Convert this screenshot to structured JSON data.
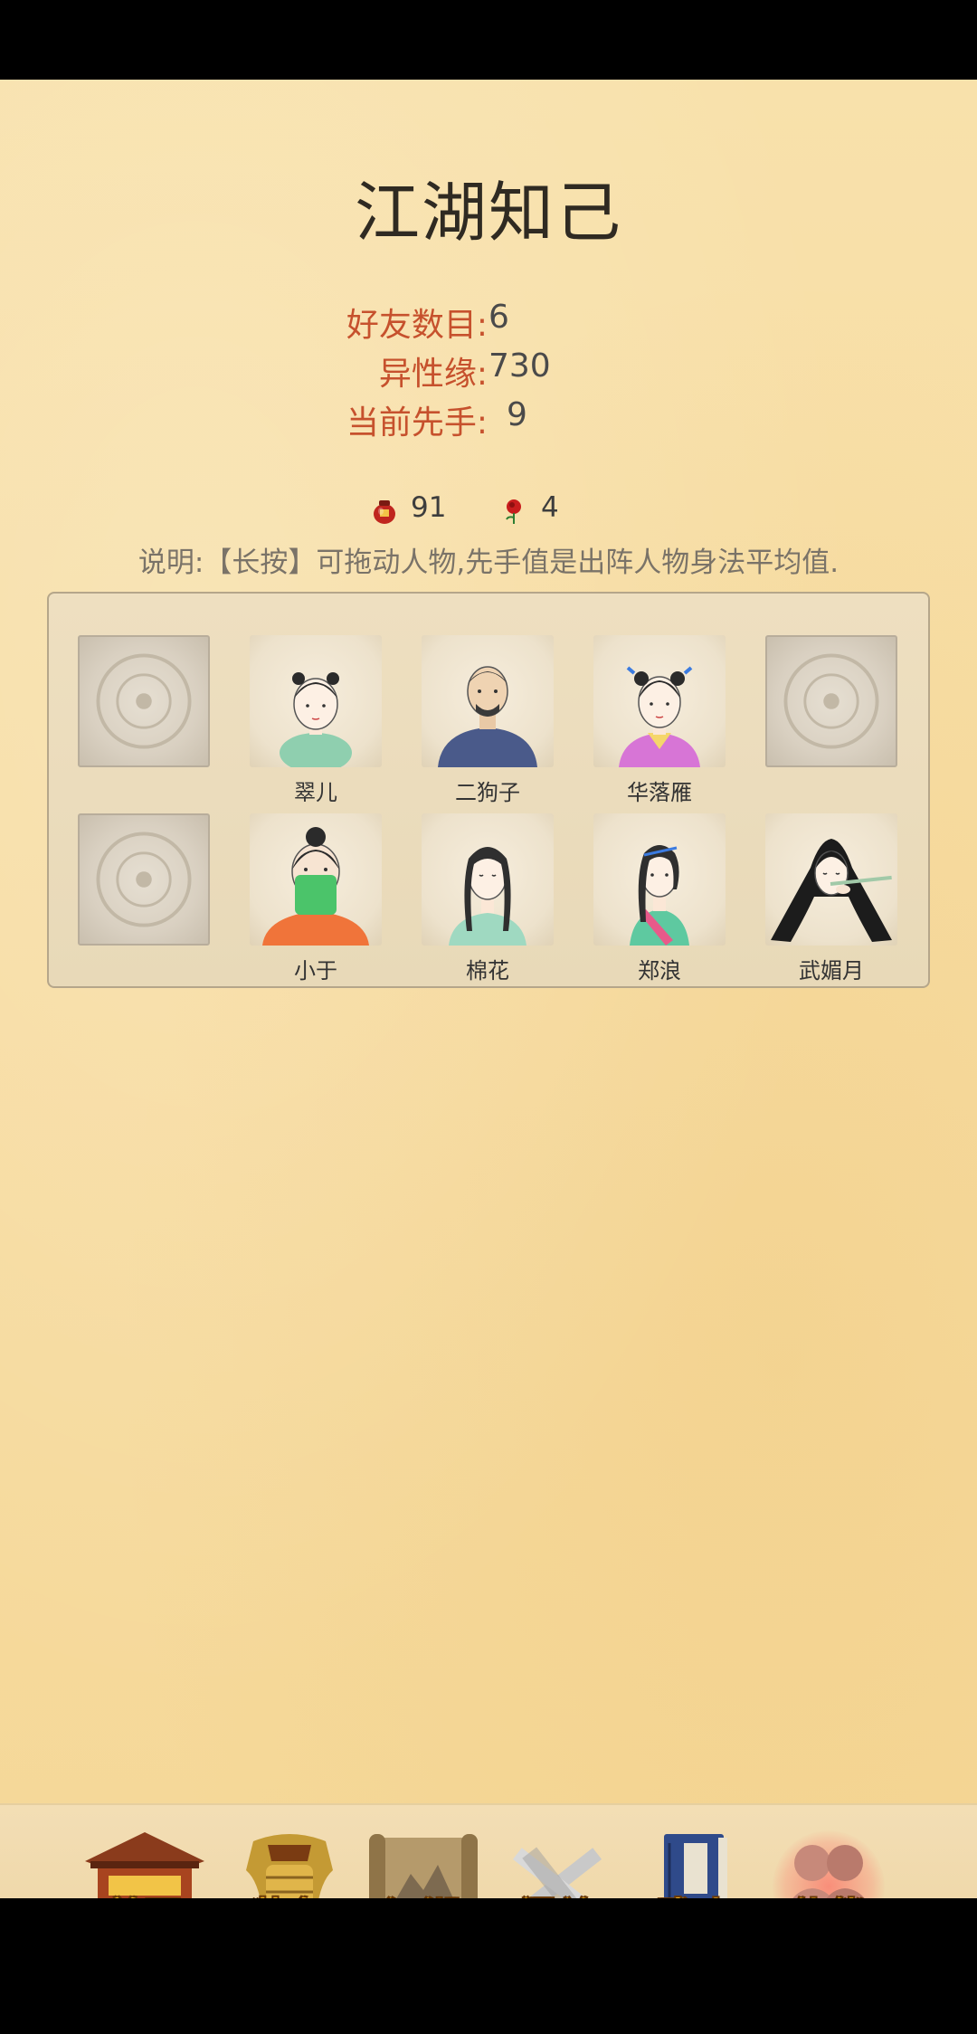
{
  "page": {
    "title": "江湖知己"
  },
  "stats": [
    {
      "label": "好友数目:",
      "value": "6"
    },
    {
      "label": "异性缘:",
      "value": "730"
    },
    {
      "label": "当前先手:",
      "value": "9"
    }
  ],
  "resources": [
    {
      "icon": "wine-jar-icon",
      "value": "91"
    },
    {
      "icon": "rose-icon",
      "value": "4"
    }
  ],
  "instructions": "说明:【长按】可拖动人物,先手值是出阵人物身法平均值.",
  "lineup": {
    "row1": [
      {
        "name": "",
        "empty": true
      },
      {
        "name": "翠儿",
        "empty": false
      },
      {
        "name": "二狗子",
        "empty": false
      },
      {
        "name": "华落雁",
        "empty": false
      },
      {
        "name": "",
        "empty": true
      }
    ],
    "row2": [
      {
        "name": "",
        "empty": true
      },
      {
        "name": "小于",
        "empty": false
      },
      {
        "name": "棉花",
        "empty": false
      },
      {
        "name": "郑浪",
        "empty": false
      },
      {
        "name": "武媚月",
        "empty": false
      }
    ]
  },
  "nav": {
    "items": [
      {
        "label": "首页",
        "icon": "temple-icon"
      },
      {
        "label": "装备",
        "icon": "armor-icon"
      },
      {
        "label": "江湖",
        "icon": "scroll-map-icon"
      },
      {
        "label": "闯关",
        "icon": "crossed-swords-icon"
      },
      {
        "label": "武功",
        "icon": "book-icon"
      },
      {
        "label": "伙伴",
        "icon": "partners-icon"
      }
    ],
    "active": "伙伴"
  },
  "colors": {
    "background": "#f7dca1",
    "label_red": "#c6512d",
    "nav_gold": "#f0b424"
  }
}
